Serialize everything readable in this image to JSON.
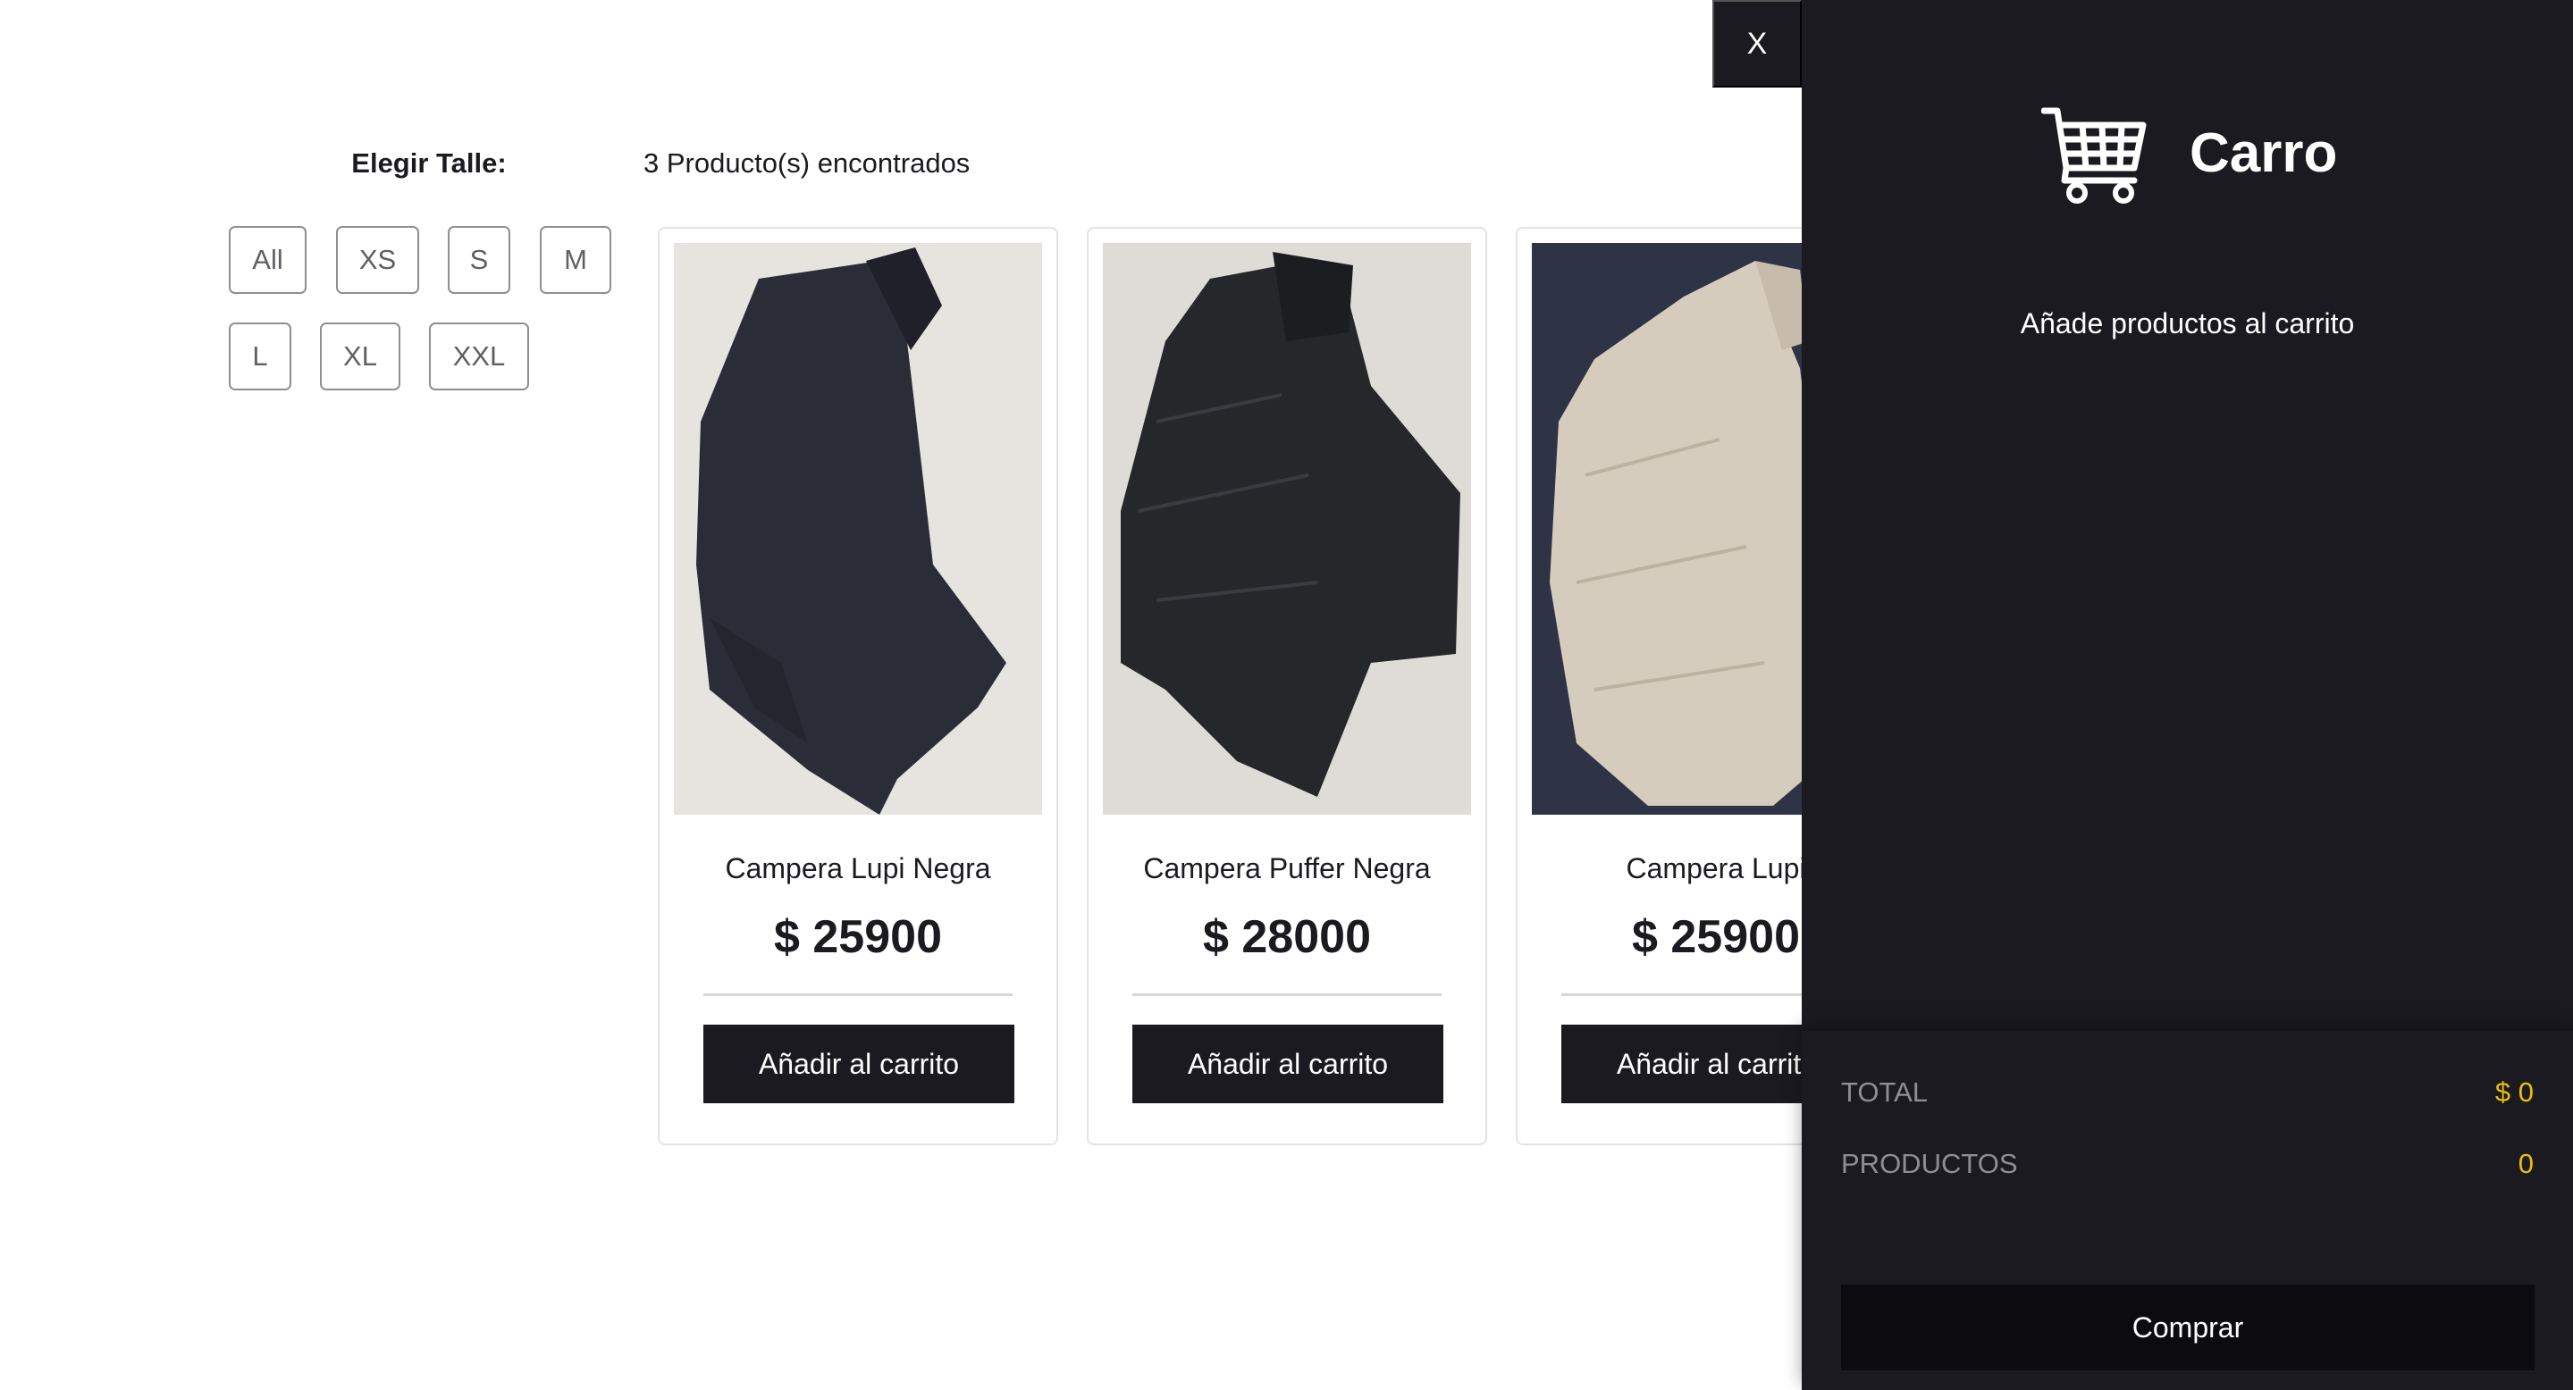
{
  "filters": {
    "title": "Elegir Talle:",
    "sizes": [
      "All",
      "XS",
      "S",
      "M",
      "L",
      "XL",
      "XXL"
    ]
  },
  "shelf": {
    "found_text": "3 Producto(s) encontrados",
    "products": [
      {
        "name": "Campera Lupi Negra",
        "price": "$ 25900",
        "button": "Añadir al carrito",
        "color": "#2a2c38",
        "background": "#e6e4df"
      },
      {
        "name": "Campera Puffer Negra",
        "price": "$ 28000",
        "button": "Añadir al carrito",
        "color": "#26272a",
        "background": "#dedcd6"
      },
      {
        "name": "Campera Lupi",
        "price": "$ 25900",
        "button": "Añadir al carrito",
        "color": "#d6ccbd",
        "background": "#2e3346"
      }
    ]
  },
  "cart": {
    "close_label": "X",
    "title": "Carro",
    "icon": "shopping-cart-icon",
    "empty_message": "Añade productos al carrito",
    "total_label": "TOTAL",
    "total_value": "$ 0",
    "products_label": "PRODUCTOS",
    "products_value": "0",
    "checkout_label": "Comprar"
  },
  "colors": {
    "dark": "#1b1a20",
    "accent": "#eabf00",
    "muted": "#8e8e93"
  }
}
